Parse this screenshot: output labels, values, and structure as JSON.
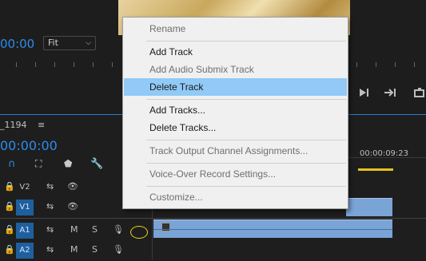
{
  "monitor": {
    "timecode": "00:00",
    "fit_label": "Fit",
    "fit_chevron": "chevron-down-icon"
  },
  "transport": {
    "step_forward_icon": "step-forward-icon",
    "go_out_icon": "go-to-out-icon",
    "export_frame_icon": "export-frame-icon"
  },
  "timeline": {
    "sequence_name": "_1194",
    "menu_icon": "hamburger-icon",
    "timecode": "00:00:00",
    "ruler_time": "00:00:09:23",
    "tracks": [
      {
        "name": "V2",
        "active": false
      },
      {
        "name": "V1",
        "active": true
      },
      {
        "name": "A1",
        "active": true,
        "m": "M",
        "s": "S"
      },
      {
        "name": "A2",
        "active": true,
        "m": "M",
        "s": "S"
      }
    ]
  },
  "context_menu": {
    "items": [
      {
        "label": "Rename",
        "enabled": false
      },
      {
        "label": "Add Track",
        "enabled": true
      },
      {
        "label": "Add Audio Submix Track",
        "enabled": false
      },
      {
        "label": "Delete Track",
        "enabled": true,
        "highlighted": true
      },
      {
        "label": "Add Tracks...",
        "enabled": true
      },
      {
        "label": "Delete Tracks...",
        "enabled": true
      },
      {
        "label": "Track Output Channel Assignments...",
        "enabled": false
      },
      {
        "label": "Voice-Over Record Settings...",
        "enabled": false
      },
      {
        "label": "Customize...",
        "enabled": false
      }
    ]
  },
  "colors": {
    "accent": "#2d8ceb",
    "menu_highlight": "#91c9f7",
    "clip": "#7aa3d6",
    "annotation_circle": "#e6d21e"
  }
}
